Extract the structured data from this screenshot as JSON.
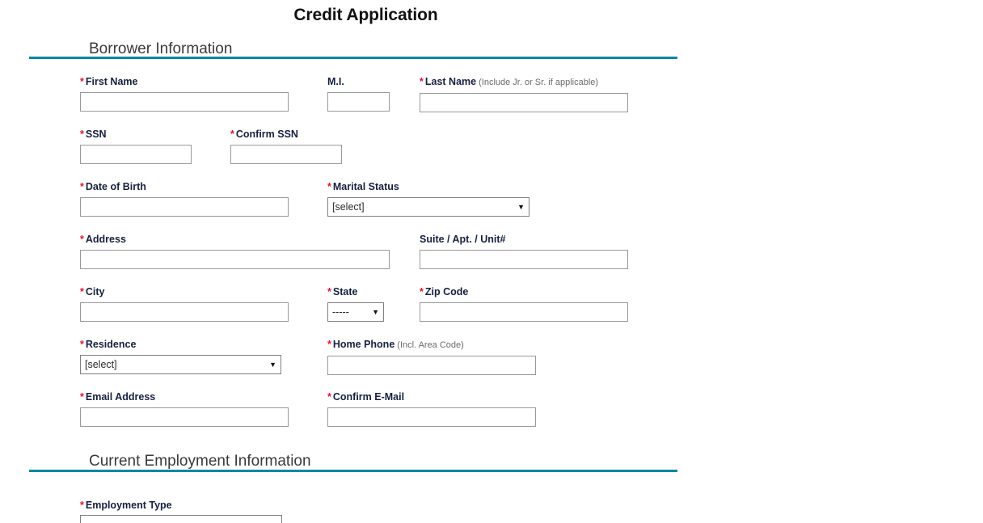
{
  "page": {
    "title": "Credit Application",
    "accent_color": "#0b87a6",
    "required_marker": "*",
    "required_color": "#e8112d"
  },
  "sections": [
    {
      "id": "borrower-information",
      "heading": "Borrower Information"
    },
    {
      "id": "current-employment-information",
      "heading": "Current Employment Information"
    }
  ],
  "fields": {
    "first_name": {
      "label": "First Name",
      "required": true,
      "value": "",
      "hint": ""
    },
    "middle_initial": {
      "label": "M.I.",
      "required": false,
      "value": "",
      "hint": ""
    },
    "last_name": {
      "label": "Last Name",
      "required": true,
      "value": "",
      "hint": "(Include Jr. or Sr. if applicable)"
    },
    "ssn": {
      "label": "SSN",
      "required": true,
      "value": "",
      "hint": ""
    },
    "confirm_ssn": {
      "label": "Confirm SSN",
      "required": true,
      "value": "",
      "hint": ""
    },
    "date_of_birth": {
      "label": "Date of Birth",
      "required": true,
      "value": "",
      "hint": ""
    },
    "marital_status": {
      "label": "Marital Status",
      "required": true,
      "value": "[select]",
      "hint": ""
    },
    "address": {
      "label": "Address",
      "required": true,
      "value": "",
      "hint": ""
    },
    "suite": {
      "label": "Suite / Apt. / Unit#",
      "required": false,
      "value": "",
      "hint": ""
    },
    "city": {
      "label": "City",
      "required": true,
      "value": "",
      "hint": ""
    },
    "state": {
      "label": "State",
      "required": true,
      "value": "-----",
      "hint": ""
    },
    "zip_code": {
      "label": "Zip Code",
      "required": true,
      "value": "",
      "hint": ""
    },
    "residence": {
      "label": "Residence",
      "required": true,
      "value": "[select]",
      "hint": ""
    },
    "home_phone": {
      "label": "Home Phone",
      "required": true,
      "value": "",
      "hint": "(Incl. Area Code)"
    },
    "email_address": {
      "label": "Email Address",
      "required": true,
      "value": "",
      "hint": ""
    },
    "confirm_email": {
      "label": "Confirm E-Mail",
      "required": true,
      "value": "",
      "hint": ""
    },
    "employment_type": {
      "label": "Employment Type",
      "required": true,
      "value": "",
      "hint": ""
    }
  },
  "icons": {
    "dropdown_arrow": "▼"
  }
}
